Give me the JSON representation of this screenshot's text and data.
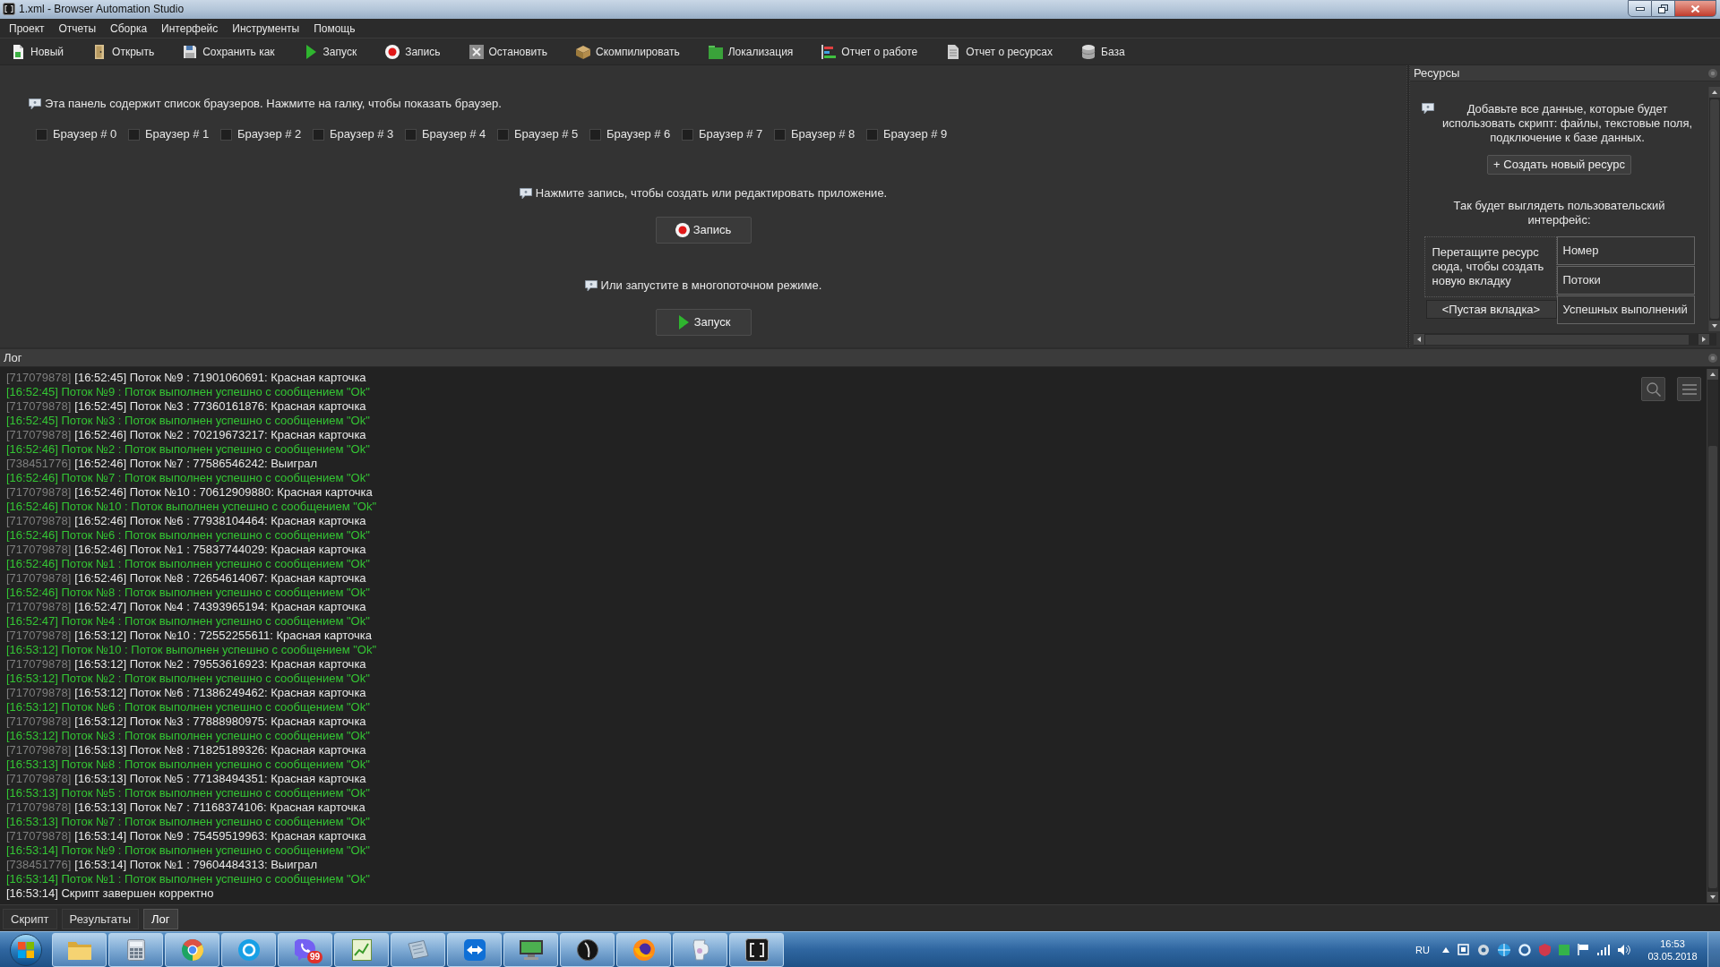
{
  "window": {
    "title": "1.xml - Browser Automation Studio"
  },
  "menu": [
    "Проект",
    "Отчеты",
    "Сборка",
    "Интерфейс",
    "Инструменты",
    "Помощь"
  ],
  "toolbar": [
    {
      "label": "Новый",
      "kind": "new"
    },
    {
      "label": "Открыть",
      "kind": "open"
    },
    {
      "label": "Сохранить как",
      "kind": "save"
    },
    {
      "label": "Запуск",
      "kind": "run"
    },
    {
      "label": "Запись",
      "kind": "record"
    },
    {
      "label": "Остановить",
      "kind": "stop"
    },
    {
      "label": "Скомпилировать",
      "kind": "compile"
    },
    {
      "label": "Локализация",
      "kind": "localize"
    },
    {
      "label": "Отчет о работе",
      "kind": "report"
    },
    {
      "label": "Отчет о ресурсах",
      "kind": "resources"
    },
    {
      "label": "База",
      "kind": "database"
    }
  ],
  "browsers": {
    "hint": "Эта панель содержит список браузеров. Нажмите на галку, чтобы показать браузер.",
    "items": [
      {
        "label": "Браузер # 0",
        "checked": false
      },
      {
        "label": "Браузер # 1",
        "checked": false
      },
      {
        "label": "Браузер # 2",
        "checked": false
      },
      {
        "label": "Браузер # 3",
        "checked": false
      },
      {
        "label": "Браузер # 4",
        "checked": false
      },
      {
        "label": "Браузер # 5",
        "checked": false
      },
      {
        "label": "Браузер # 6",
        "checked": false
      },
      {
        "label": "Браузер # 7",
        "checked": false
      },
      {
        "label": "Браузер # 8",
        "checked": false
      },
      {
        "label": "Браузер # 9",
        "checked": false
      }
    ]
  },
  "record": {
    "hint": "Нажмите запись, чтобы создать или редактировать приложение.",
    "button": "Запись"
  },
  "run": {
    "hint": "Или запустите в многопоточном режиме.",
    "button": "Запуск"
  },
  "resources": {
    "title": "Ресурсы",
    "hint": "Добавьте все данные, которые будет использовать скрипт: файлы, текстовые поля, подключение к базе данных.",
    "create_button": "+ Создать новый ресурс",
    "preview_caption": "Так будет выглядеть пользовательский интерфейс:",
    "drop_zone": "Перетащите ресурс сюда, чтобы создать новую вкладку",
    "empty_tab": "<Пустая вкладка>",
    "fields": [
      "Номер",
      "Потоки",
      "Успешных выполнений"
    ]
  },
  "log": {
    "title": "Лог",
    "lines": [
      {
        "kind": "info",
        "source": "[717079878]",
        "text": "[16:52:45] Поток №9 : 71901060691: Красная карточка"
      },
      {
        "kind": "success",
        "text": "[16:52:45] Поток №9 : Поток выполнен успешно с сообщением \"Ok\""
      },
      {
        "kind": "info",
        "source": "[717079878]",
        "text": "[16:52:45] Поток №3 : 77360161876: Красная карточка"
      },
      {
        "kind": "success",
        "text": "[16:52:45] Поток №3 : Поток выполнен успешно с сообщением \"Ok\""
      },
      {
        "kind": "info",
        "source": "[717079878]",
        "text": "[16:52:46] Поток №2 : 70219673217: Красная карточка"
      },
      {
        "kind": "success",
        "text": "[16:52:46] Поток №2 : Поток выполнен успешно с сообщением \"Ok\""
      },
      {
        "kind": "info",
        "source": "[738451776]",
        "text": "[16:52:46] Поток №7 : 77586546242: Выиграл"
      },
      {
        "kind": "success",
        "text": "[16:52:46] Поток №7 : Поток выполнен успешно с сообщением \"Ok\""
      },
      {
        "kind": "info",
        "source": "[717079878]",
        "text": "[16:52:46] Поток №10 : 70612909880: Красная карточка"
      },
      {
        "kind": "success",
        "text": "[16:52:46] Поток №10 : Поток выполнен успешно с сообщением \"Ok\""
      },
      {
        "kind": "info",
        "source": "[717079878]",
        "text": "[16:52:46] Поток №6 : 77938104464: Красная карточка"
      },
      {
        "kind": "success",
        "text": "[16:52:46] Поток №6 : Поток выполнен успешно с сообщением \"Ok\""
      },
      {
        "kind": "info",
        "source": "[717079878]",
        "text": "[16:52:46] Поток №1 : 75837744029: Красная карточка"
      },
      {
        "kind": "success",
        "text": "[16:52:46] Поток №1 : Поток выполнен успешно с сообщением \"Ok\""
      },
      {
        "kind": "info",
        "source": "[717079878]",
        "text": "[16:52:46] Поток №8 : 72654614067: Красная карточка"
      },
      {
        "kind": "success",
        "text": "[16:52:46] Поток №8 : Поток выполнен успешно с сообщением \"Ok\""
      },
      {
        "kind": "info",
        "source": "[717079878]",
        "text": "[16:52:47] Поток №4 : 74393965194: Красная карточка"
      },
      {
        "kind": "success",
        "text": "[16:52:47] Поток №4 : Поток выполнен успешно с сообщением \"Ok\""
      },
      {
        "kind": "info",
        "source": "[717079878]",
        "text": "[16:53:12] Поток №10 : 72552255611: Красная карточка"
      },
      {
        "kind": "success",
        "text": "[16:53:12] Поток №10 : Поток выполнен успешно с сообщением \"Ok\""
      },
      {
        "kind": "info",
        "source": "[717079878]",
        "text": "[16:53:12] Поток №2 : 79553616923: Красная карточка"
      },
      {
        "kind": "success",
        "text": "[16:53:12] Поток №2 : Поток выполнен успешно с сообщением \"Ok\""
      },
      {
        "kind": "info",
        "source": "[717079878]",
        "text": "[16:53:12] Поток №6 : 71386249462: Красная карточка"
      },
      {
        "kind": "success",
        "text": "[16:53:12] Поток №6 : Поток выполнен успешно с сообщением \"Ok\""
      },
      {
        "kind": "info",
        "source": "[717079878]",
        "text": "[16:53:12] Поток №3 : 77888980975: Красная карточка"
      },
      {
        "kind": "success",
        "text": "[16:53:12] Поток №3 : Поток выполнен успешно с сообщением \"Ok\""
      },
      {
        "kind": "info",
        "source": "[717079878]",
        "text": "[16:53:13] Поток №8 : 71825189326: Красная карточка"
      },
      {
        "kind": "success",
        "text": "[16:53:13] Поток №8 : Поток выполнен успешно с сообщением \"Ok\""
      },
      {
        "kind": "info",
        "source": "[717079878]",
        "text": "[16:53:13] Поток №5 : 77138494351: Красная карточка"
      },
      {
        "kind": "success",
        "text": "[16:53:13] Поток №5 : Поток выполнен успешно с сообщением \"Ok\""
      },
      {
        "kind": "info",
        "source": "[717079878]",
        "text": "[16:53:13] Поток №7 : 71168374106: Красная карточка"
      },
      {
        "kind": "success",
        "text": "[16:53:13] Поток №7 : Поток выполнен успешно с сообщением \"Ok\""
      },
      {
        "kind": "info",
        "source": "[717079878]",
        "text": "[16:53:14] Поток №9 : 75459519963: Красная карточка"
      },
      {
        "kind": "success",
        "text": "[16:53:14] Поток №9 : Поток выполнен успешно с сообщением \"Ok\""
      },
      {
        "kind": "info",
        "source": "[738451776]",
        "text": "[16:53:14] Поток №1 : 79604484313: Выиграл"
      },
      {
        "kind": "success",
        "text": "[16:53:14] Поток №1 : Поток выполнен успешно с сообщением \"Ok\""
      },
      {
        "kind": "info",
        "text": "[16:53:14] Скрипт завершен корректно"
      }
    ]
  },
  "bottom_tabs": [
    {
      "label": "Скрипт",
      "selected": false
    },
    {
      "label": "Результаты",
      "selected": false
    },
    {
      "label": "Лог",
      "selected": true
    }
  ],
  "taskbar": {
    "apps": [
      {
        "kind": "folder"
      },
      {
        "kind": "calculator"
      },
      {
        "kind": "ball"
      },
      {
        "kind": "chat"
      },
      {
        "kind": "phone",
        "badge": "99"
      },
      {
        "kind": "chart"
      },
      {
        "kind": "notebook"
      },
      {
        "kind": "arrows"
      },
      {
        "kind": "monitor"
      },
      {
        "kind": "disc"
      },
      {
        "kind": "globe"
      },
      {
        "kind": "jug"
      },
      {
        "kind": "frame"
      }
    ],
    "language": "RU",
    "time": "16:53",
    "date": "03.05.2018"
  }
}
